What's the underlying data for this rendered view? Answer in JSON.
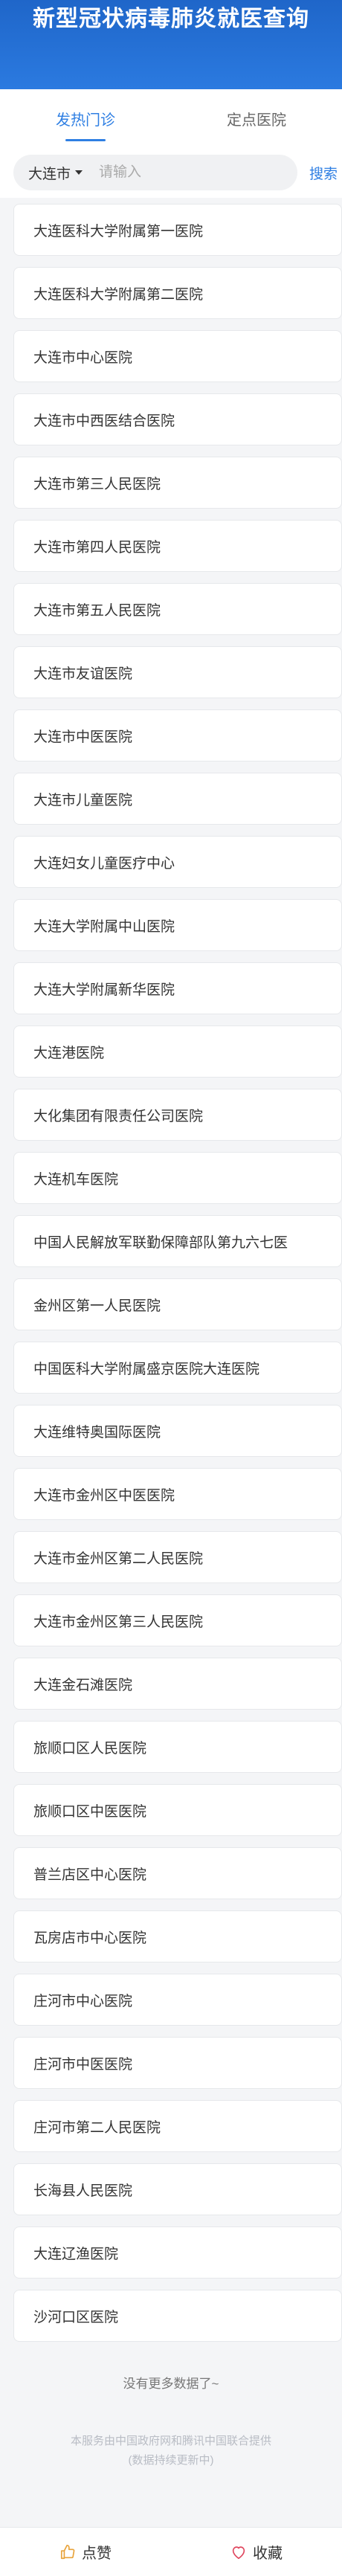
{
  "header": {
    "title": "新型冠状病毒肺炎就医查询"
  },
  "tabs": [
    {
      "label": "发热门诊",
      "active": true
    },
    {
      "label": "定点医院",
      "active": false
    }
  ],
  "search": {
    "city": "大连市",
    "placeholder": "请输入",
    "button_label": "搜索"
  },
  "hospitals": [
    "大连医科大学附属第一医院",
    "大连医科大学附属第二医院",
    "大连市中心医院",
    "大连市中西医结合医院",
    "大连市第三人民医院",
    "大连市第四人民医院",
    "大连市第五人民医院",
    "大连市友谊医院",
    "大连市中医医院",
    "大连市儿童医院",
    "大连妇女儿童医疗中心",
    "大连大学附属中山医院",
    "大连大学附属新华医院",
    "大连港医院",
    "大化集团有限责任公司医院",
    "大连机车医院",
    "中国人民解放军联勤保障部队第九六七医",
    "金州区第一人民医院",
    "中国医科大学附属盛京医院大连医院",
    "大连维特奥国际医院",
    "大连市金州区中医医院",
    "大连市金州区第二人民医院",
    "大连市金州区第三人民医院",
    "大连金石滩医院",
    "旅顺口区人民医院",
    "旅顺口区中医医院",
    "普兰店区中心医院",
    "瓦房店市中心医院",
    "庄河市中心医院",
    "庄河市中医医院",
    "庄河市第二人民医院",
    "长海县人民医院",
    "大连辽渔医院",
    "沙河口区医院"
  ],
  "footer": {
    "no_more": "没有更多数据了~",
    "source_line1": "本服务由中国政府网和腾讯中国联合提供",
    "source_line2": "(数据持续更新中)"
  },
  "bottom_bar": {
    "like_label": "点赞",
    "favorite_label": "收藏"
  },
  "colors": {
    "accent": "#2f7fe3",
    "header_bg": "#2570d6",
    "like_icon": "#e8a33a",
    "favorite_icon": "#e0475f"
  }
}
